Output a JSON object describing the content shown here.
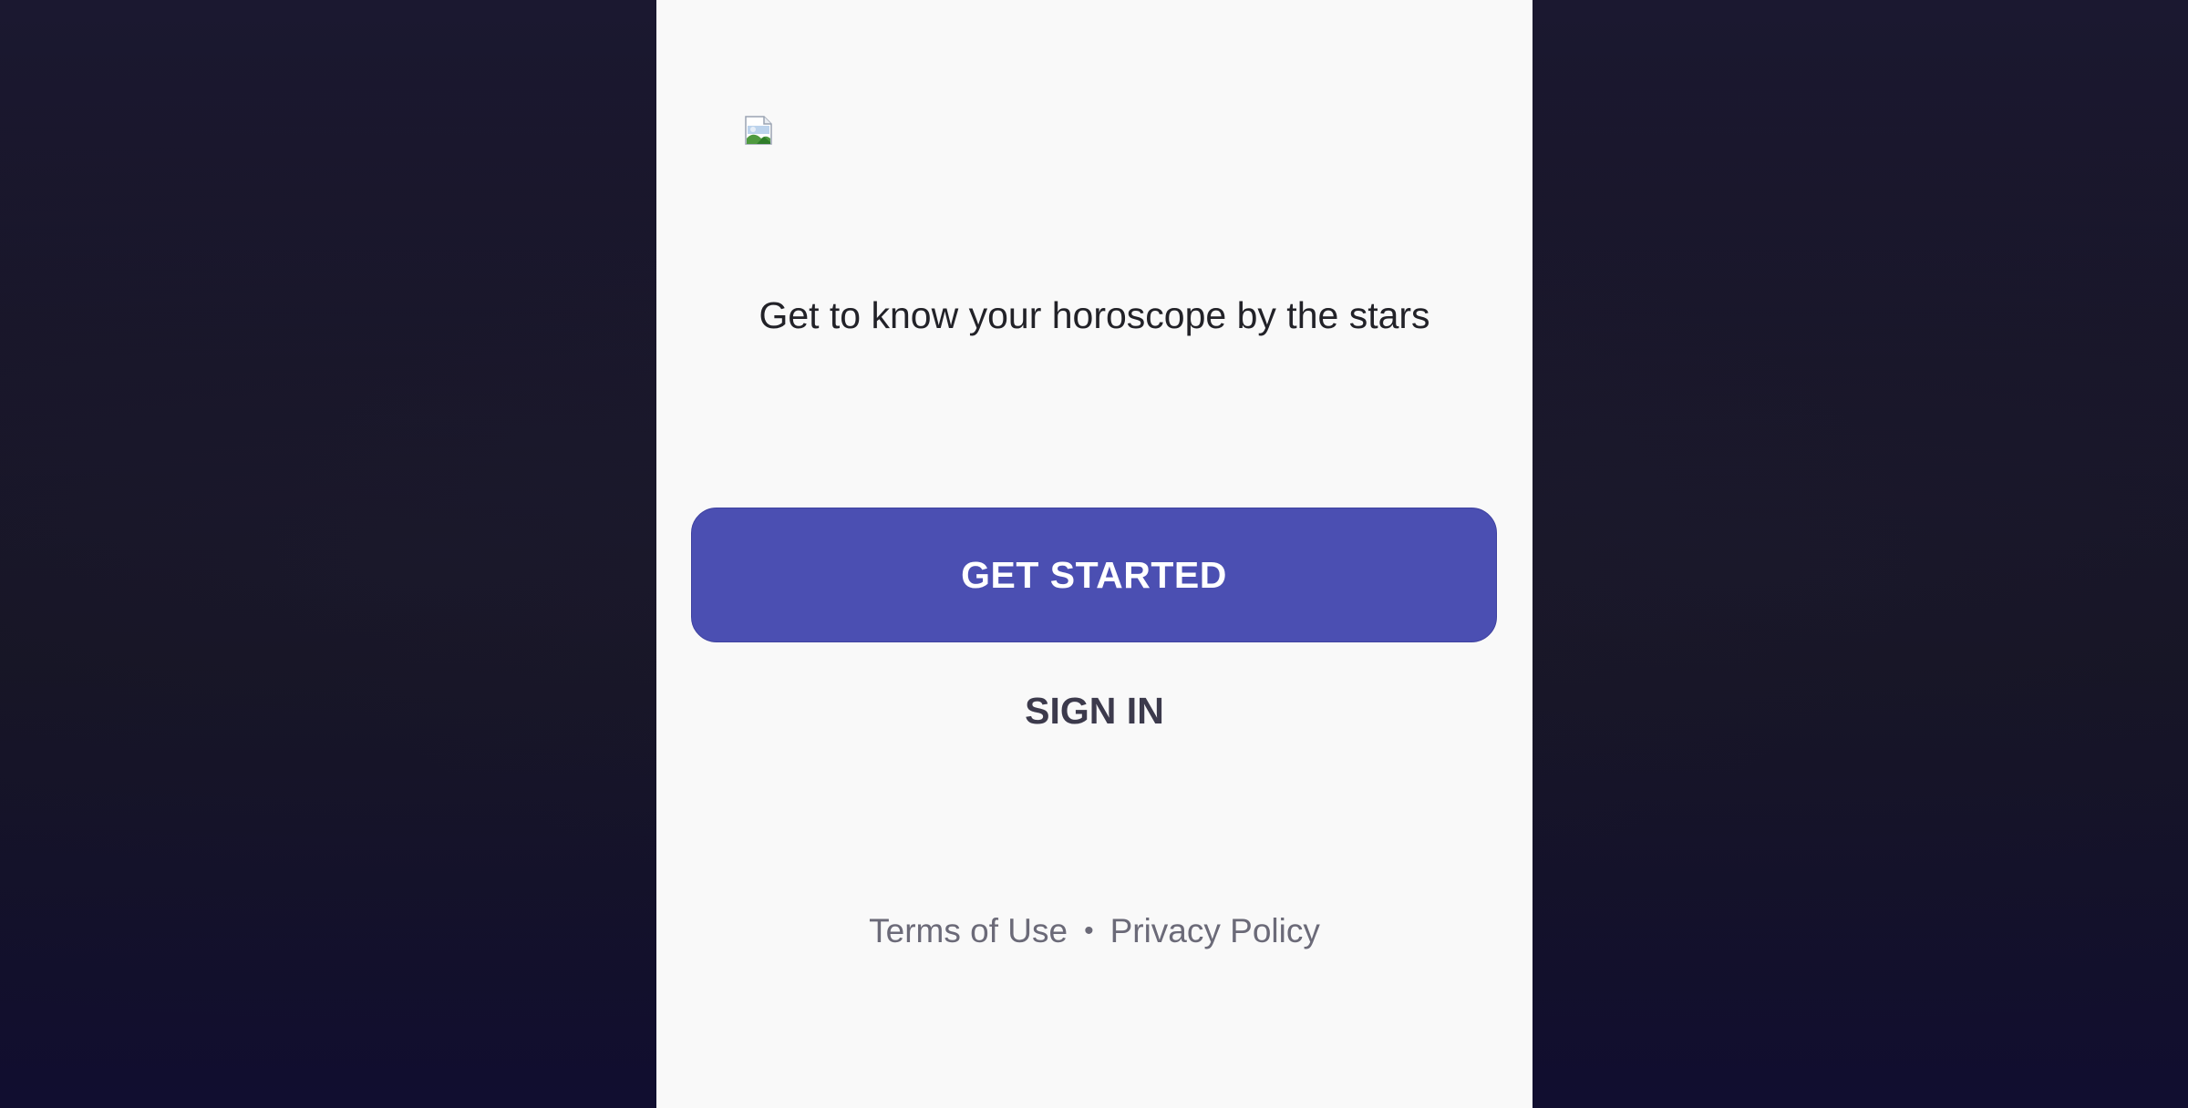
{
  "app": {
    "tagline": "Get to know your horoscope by the stars"
  },
  "logo": {
    "icon": "broken-image-icon"
  },
  "actions": {
    "get_started_label": "GET STARTED",
    "sign_in_label": "SIGN IN"
  },
  "footer": {
    "terms_label": "Terms of Use",
    "separator": "•",
    "privacy_label": "Privacy Policy"
  },
  "colors": {
    "background_dark": "#171528",
    "panel": "#f9f9f9",
    "primary_button": "#4b4fb2",
    "text_dark": "#222228",
    "text_muted": "#6b6a78",
    "sign_in_text": "#3c3a4c"
  }
}
